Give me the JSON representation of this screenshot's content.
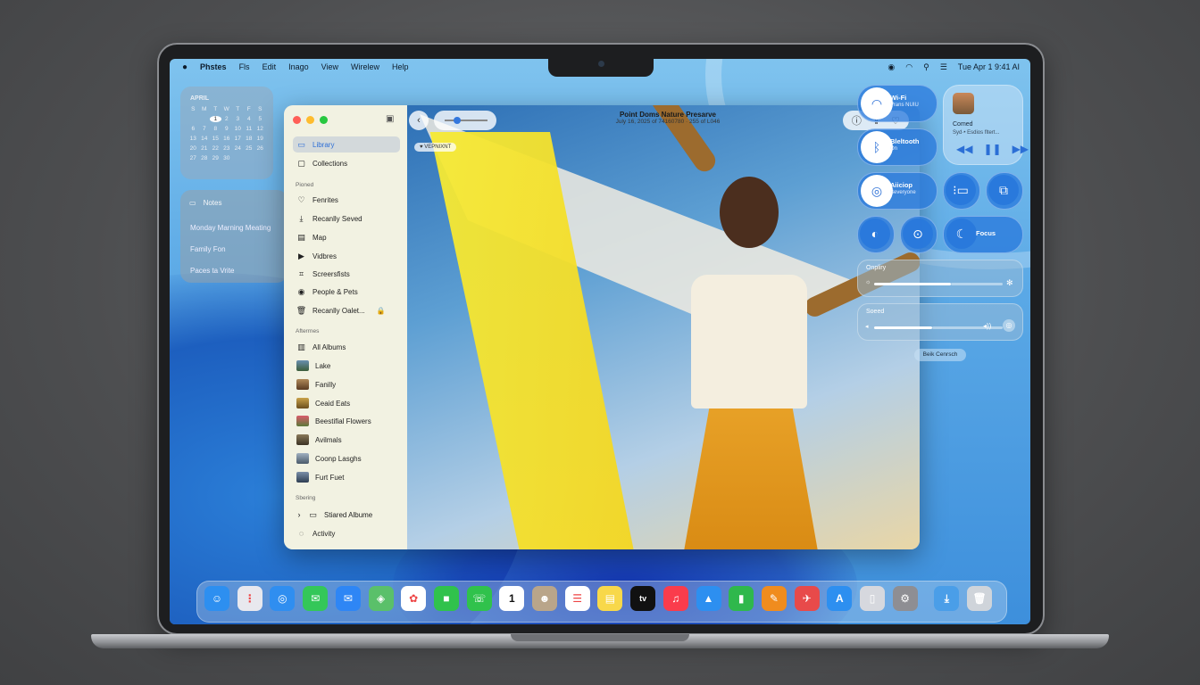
{
  "menubar": {
    "app": "Phstes",
    "menus": [
      "Fls",
      "Edit",
      "Inago",
      "View",
      "Wirelew",
      "Help"
    ],
    "clock": "Tue Apr 1  9:41 AI"
  },
  "calendar": {
    "month": "APRIL",
    "weekdays": [
      "S",
      "M",
      "T",
      "W",
      "T",
      "F",
      "S"
    ],
    "rows": [
      [
        "",
        "",
        "1",
        "2",
        "3",
        "4",
        "5"
      ],
      [
        "6",
        "7",
        "8",
        "9",
        "10",
        "11",
        "12"
      ],
      [
        "13",
        "14",
        "15",
        "16",
        "17",
        "18",
        "19"
      ],
      [
        "20",
        "21",
        "22",
        "23",
        "24",
        "25",
        "26"
      ],
      [
        "27",
        "28",
        "29",
        "30",
        "",
        "",
        ""
      ]
    ],
    "today": "1"
  },
  "notes": {
    "title": "Notes",
    "items": [
      "Monday Marning Meating",
      "Family Fon",
      "Paces ta Vrite"
    ]
  },
  "photos": {
    "title": "Point Doms Nature Presarve",
    "subtitle": "July 16, 2025 of 74160780  ·  255 of L046",
    "favorite_tag": "♥ VEPNIXNT",
    "zoom_level": 0.3,
    "sidebar": {
      "library": "Library",
      "collections": "Collections",
      "pinned_header": "Pioned",
      "pinned": [
        "Fenrites",
        "Recanlly Seved",
        "Map",
        "Vidbres",
        "Screersfists",
        "People & Pets",
        "Recanlly Oalet..."
      ],
      "albums_header": "Afterrnes",
      "all_albums": "All Albums",
      "albums": [
        "Lake",
        "Fanilly",
        "Ceaid Eats",
        "Beestifial Flowers",
        "Avilmals",
        "Coonp Lasghs",
        "Furt Fuet"
      ],
      "sharing_header": "Sbering",
      "shared_albums": "Stiared Albume",
      "activity": "Activity"
    }
  },
  "control_center": {
    "wifi": {
      "label": "Wi-Fi",
      "sub": "Vrans NUIU"
    },
    "bluetooth": {
      "label": "Bleltooth",
      "sub": "On"
    },
    "airdrop": {
      "label": "Aiiciop",
      "sub": "Beveryone"
    },
    "focus": {
      "label": "Focus"
    },
    "now_playing": {
      "title": "Comed",
      "artist": "Syd·• Esdios fltert..."
    },
    "display": {
      "label": "Onpliry",
      "value": 0.6
    },
    "sound": {
      "label": "Soeed",
      "value": 0.45
    },
    "edit": "Beik Cenrsch"
  },
  "dock": {
    "apps": [
      "finder",
      "launchpad",
      "safari",
      "messages",
      "mail",
      "maps",
      "photos",
      "facetime",
      "phone",
      "calendar",
      "contacts",
      "reminders",
      "notes",
      "tv",
      "music",
      "keynote",
      "numbers",
      "pages",
      "testflight",
      "app-store",
      "iphone-mirroring",
      "system-settings",
      "downloads",
      "trash"
    ],
    "calendar_day": "1",
    "tv_label": "tv"
  }
}
